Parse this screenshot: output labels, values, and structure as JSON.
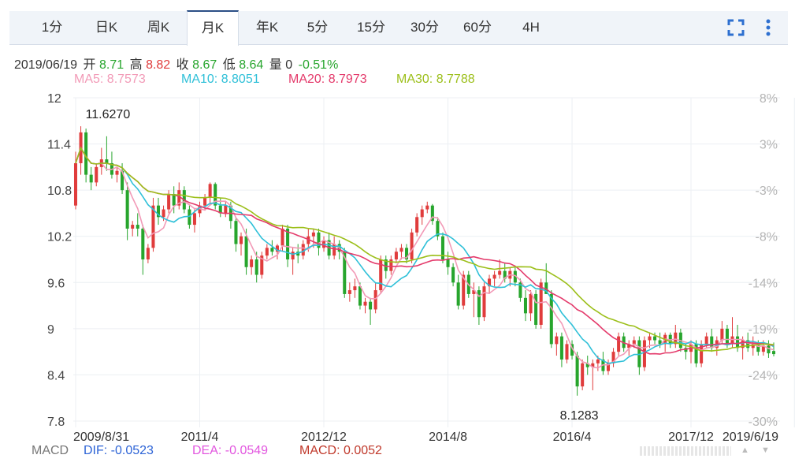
{
  "tabs": [
    {
      "label": "1分"
    },
    {
      "label": "日K"
    },
    {
      "label": "周K"
    },
    {
      "label": "月K",
      "active": true
    },
    {
      "label": "年K"
    },
    {
      "label": "5分"
    },
    {
      "label": "15分"
    },
    {
      "label": "30分"
    },
    {
      "label": "60分"
    },
    {
      "label": "4H"
    }
  ],
  "tools": {
    "fullscreen_icon": "fullscreen-icon",
    "more_icon": "more-vertical-icon"
  },
  "info": {
    "date": "2019/06/19",
    "open_label": "开",
    "open": "8.71",
    "high_label": "高",
    "high": "8.82",
    "close_label": "收",
    "close": "8.67",
    "low_label": "低",
    "low": "8.64",
    "vol_label": "量",
    "vol": "0",
    "change": "-0.51%"
  },
  "ma": {
    "ma5": "MA5: 8.7573",
    "ma10": "MA10: 8.8051",
    "ma20": "MA20: 8.7973",
    "ma30": "MA30: 8.7788"
  },
  "macd": {
    "name": "MACD",
    "dif": "DIF: -0.0523",
    "dea": "DEA: -0.0549",
    "macd": "MACD: 0.0052"
  },
  "colors": {
    "up": "#e03c3c",
    "down": "#27a52d",
    "ma5": "#f29ab7",
    "ma10": "#2fc0d8",
    "ma20": "#e43a6b",
    "ma30": "#9cbf1a",
    "dif": "#2c63d6",
    "dea": "#e256df",
    "macd": "#c0392b"
  },
  "chart_data": {
    "type": "candlestick",
    "ylim": [
      7.8,
      12
    ],
    "y_ticks": [
      "12",
      "11.4",
      "10.8",
      "10.2",
      "9.6",
      "9",
      "8.4",
      "7.8"
    ],
    "pct_ticks": [
      "8%",
      "3%",
      "-3%",
      "-8%",
      "-14%",
      "-19%",
      "-24%",
      "-30%"
    ],
    "x_ticks": [
      "2009/8/31",
      "2011/4",
      "2012/12",
      "2014/8",
      "2016/4",
      "2017/12",
      "2019/6/19"
    ],
    "max_label": "11.6270",
    "min_label": "8.1283",
    "candles": [
      {
        "o": 10.6,
        "h": 11.3,
        "l": 10.55,
        "c": 11.15
      },
      {
        "o": 11.15,
        "h": 11.63,
        "l": 11.0,
        "c": 11.55
      },
      {
        "o": 11.55,
        "h": 11.6,
        "l": 10.9,
        "c": 11.0
      },
      {
        "o": 11.0,
        "h": 11.1,
        "l": 10.8,
        "c": 10.9
      },
      {
        "o": 10.9,
        "h": 11.15,
        "l": 10.85,
        "c": 11.1
      },
      {
        "o": 11.1,
        "h": 11.35,
        "l": 11.0,
        "c": 11.2
      },
      {
        "o": 11.2,
        "h": 11.5,
        "l": 11.05,
        "c": 11.15
      },
      {
        "o": 11.15,
        "h": 11.3,
        "l": 10.95,
        "c": 11.0
      },
      {
        "o": 11.0,
        "h": 11.1,
        "l": 10.9,
        "c": 11.05
      },
      {
        "o": 11.05,
        "h": 11.15,
        "l": 10.75,
        "c": 10.8
      },
      {
        "o": 10.8,
        "h": 10.9,
        "l": 10.15,
        "c": 10.3
      },
      {
        "o": 10.3,
        "h": 10.4,
        "l": 10.2,
        "c": 10.35
      },
      {
        "o": 10.35,
        "h": 10.5,
        "l": 10.2,
        "c": 10.3
      },
      {
        "o": 10.3,
        "h": 10.35,
        "l": 9.7,
        "c": 9.9
      },
      {
        "o": 9.9,
        "h": 10.1,
        "l": 9.85,
        "c": 10.05
      },
      {
        "o": 10.05,
        "h": 10.7,
        "l": 10.0,
        "c": 10.6
      },
      {
        "o": 10.6,
        "h": 10.7,
        "l": 10.35,
        "c": 10.45
      },
      {
        "o": 10.45,
        "h": 10.6,
        "l": 10.4,
        "c": 10.55
      },
      {
        "o": 10.55,
        "h": 10.8,
        "l": 10.5,
        "c": 10.75
      },
      {
        "o": 10.75,
        "h": 10.85,
        "l": 10.5,
        "c": 10.6
      },
      {
        "o": 10.6,
        "h": 10.9,
        "l": 10.55,
        "c": 10.8
      },
      {
        "o": 10.8,
        "h": 10.85,
        "l": 10.5,
        "c": 10.55
      },
      {
        "o": 10.55,
        "h": 10.6,
        "l": 10.3,
        "c": 10.35
      },
      {
        "o": 10.35,
        "h": 10.55,
        "l": 10.25,
        "c": 10.5
      },
      {
        "o": 10.5,
        "h": 10.65,
        "l": 10.45,
        "c": 10.6
      },
      {
        "o": 10.6,
        "h": 10.75,
        "l": 10.55,
        "c": 10.7
      },
      {
        "o": 10.7,
        "h": 10.9,
        "l": 10.6,
        "c": 10.88
      },
      {
        "o": 10.88,
        "h": 10.9,
        "l": 10.55,
        "c": 10.6
      },
      {
        "o": 10.6,
        "h": 10.7,
        "l": 10.45,
        "c": 10.5
      },
      {
        "o": 10.5,
        "h": 10.65,
        "l": 10.45,
        "c": 10.6
      },
      {
        "o": 10.6,
        "h": 10.65,
        "l": 10.3,
        "c": 10.4
      },
      {
        "o": 10.4,
        "h": 10.45,
        "l": 10.0,
        "c": 10.1
      },
      {
        "o": 10.1,
        "h": 10.25,
        "l": 9.95,
        "c": 10.2
      },
      {
        "o": 10.2,
        "h": 10.3,
        "l": 9.7,
        "c": 9.8
      },
      {
        "o": 9.8,
        "h": 9.95,
        "l": 9.7,
        "c": 9.9
      },
      {
        "o": 9.9,
        "h": 10.0,
        "l": 9.6,
        "c": 9.7
      },
      {
        "o": 9.7,
        "h": 10.0,
        "l": 9.65,
        "c": 9.95
      },
      {
        "o": 9.95,
        "h": 10.1,
        "l": 9.9,
        "c": 10.05
      },
      {
        "o": 10.05,
        "h": 10.15,
        "l": 9.95,
        "c": 10.0
      },
      {
        "o": 10.0,
        "h": 10.1,
        "l": 9.9,
        "c": 10.08
      },
      {
        "o": 10.08,
        "h": 10.35,
        "l": 10.0,
        "c": 10.3
      },
      {
        "o": 10.3,
        "h": 10.35,
        "l": 9.8,
        "c": 9.9
      },
      {
        "o": 9.9,
        "h": 10.05,
        "l": 9.7,
        "c": 10.0
      },
      {
        "o": 10.0,
        "h": 10.1,
        "l": 9.85,
        "c": 9.95
      },
      {
        "o": 9.95,
        "h": 10.15,
        "l": 9.9,
        "c": 10.1
      },
      {
        "o": 10.1,
        "h": 10.3,
        "l": 10.0,
        "c": 10.2
      },
      {
        "o": 10.2,
        "h": 10.3,
        "l": 10.05,
        "c": 10.25
      },
      {
        "o": 10.25,
        "h": 10.3,
        "l": 9.95,
        "c": 10.05
      },
      {
        "o": 10.05,
        "h": 10.2,
        "l": 10.0,
        "c": 10.15
      },
      {
        "o": 10.15,
        "h": 10.25,
        "l": 9.9,
        "c": 9.95
      },
      {
        "o": 9.95,
        "h": 10.2,
        "l": 9.9,
        "c": 10.1
      },
      {
        "o": 10.1,
        "h": 10.15,
        "l": 9.9,
        "c": 10.0
      },
      {
        "o": 10.0,
        "h": 10.05,
        "l": 9.4,
        "c": 9.45
      },
      {
        "o": 9.45,
        "h": 9.6,
        "l": 9.35,
        "c": 9.5
      },
      {
        "o": 9.5,
        "h": 9.65,
        "l": 9.4,
        "c": 9.55
      },
      {
        "o": 9.55,
        "h": 9.6,
        "l": 9.25,
        "c": 9.3
      },
      {
        "o": 9.3,
        "h": 9.4,
        "l": 9.2,
        "c": 9.35
      },
      {
        "o": 9.35,
        "h": 9.4,
        "l": 9.05,
        "c": 9.25
      },
      {
        "o": 9.25,
        "h": 9.6,
        "l": 9.2,
        "c": 9.5
      },
      {
        "o": 9.5,
        "h": 9.95,
        "l": 9.45,
        "c": 9.9
      },
      {
        "o": 9.9,
        "h": 9.95,
        "l": 9.65,
        "c": 9.75
      },
      {
        "o": 9.75,
        "h": 9.95,
        "l": 9.7,
        "c": 9.9
      },
      {
        "o": 9.9,
        "h": 10.05,
        "l": 9.85,
        "c": 10.0
      },
      {
        "o": 10.0,
        "h": 10.1,
        "l": 9.9,
        "c": 10.05
      },
      {
        "o": 10.05,
        "h": 10.1,
        "l": 9.85,
        "c": 9.9
      },
      {
        "o": 9.9,
        "h": 10.3,
        "l": 9.85,
        "c": 10.25
      },
      {
        "o": 10.25,
        "h": 10.5,
        "l": 10.2,
        "c": 10.45
      },
      {
        "o": 10.45,
        "h": 10.6,
        "l": 10.35,
        "c": 10.55
      },
      {
        "o": 10.55,
        "h": 10.65,
        "l": 10.5,
        "c": 10.6
      },
      {
        "o": 10.6,
        "h": 10.62,
        "l": 10.35,
        "c": 10.4
      },
      {
        "o": 10.4,
        "h": 10.45,
        "l": 10.15,
        "c": 10.2
      },
      {
        "o": 10.2,
        "h": 10.25,
        "l": 9.85,
        "c": 9.9
      },
      {
        "o": 9.9,
        "h": 10.0,
        "l": 9.7,
        "c": 9.8
      },
      {
        "o": 9.8,
        "h": 9.85,
        "l": 9.55,
        "c": 9.6
      },
      {
        "o": 9.6,
        "h": 9.7,
        "l": 9.25,
        "c": 9.3
      },
      {
        "o": 9.3,
        "h": 9.75,
        "l": 9.25,
        "c": 9.7
      },
      {
        "o": 9.7,
        "h": 9.75,
        "l": 9.4,
        "c": 9.45
      },
      {
        "o": 9.45,
        "h": 9.6,
        "l": 9.15,
        "c": 9.5
      },
      {
        "o": 9.5,
        "h": 9.55,
        "l": 9.05,
        "c": 9.15
      },
      {
        "o": 9.15,
        "h": 9.6,
        "l": 9.1,
        "c": 9.55
      },
      {
        "o": 9.55,
        "h": 9.7,
        "l": 9.45,
        "c": 9.65
      },
      {
        "o": 9.65,
        "h": 9.75,
        "l": 9.55,
        "c": 9.7
      },
      {
        "o": 9.7,
        "h": 9.9,
        "l": 9.65,
        "c": 9.75
      },
      {
        "o": 9.75,
        "h": 9.85,
        "l": 9.6,
        "c": 9.65
      },
      {
        "o": 9.65,
        "h": 9.8,
        "l": 9.55,
        "c": 9.75
      },
      {
        "o": 9.75,
        "h": 9.8,
        "l": 9.55,
        "c": 9.6
      },
      {
        "o": 9.6,
        "h": 9.65,
        "l": 9.35,
        "c": 9.4
      },
      {
        "o": 9.4,
        "h": 9.5,
        "l": 9.1,
        "c": 9.2
      },
      {
        "o": 9.2,
        "h": 9.5,
        "l": 9.1,
        "c": 9.45
      },
      {
        "o": 9.45,
        "h": 9.5,
        "l": 9.0,
        "c": 9.05
      },
      {
        "o": 9.05,
        "h": 9.65,
        "l": 9.0,
        "c": 9.6
      },
      {
        "o": 9.6,
        "h": 9.85,
        "l": 9.55,
        "c": 9.45
      },
      {
        "o": 9.45,
        "h": 9.5,
        "l": 8.75,
        "c": 8.8
      },
      {
        "o": 8.8,
        "h": 8.95,
        "l": 8.65,
        "c": 8.9
      },
      {
        "o": 8.9,
        "h": 8.95,
        "l": 8.5,
        "c": 8.6
      },
      {
        "o": 8.6,
        "h": 8.85,
        "l": 8.55,
        "c": 8.8
      },
      {
        "o": 8.8,
        "h": 8.85,
        "l": 8.6,
        "c": 8.65
      },
      {
        "o": 8.65,
        "h": 8.7,
        "l": 8.13,
        "c": 8.25
      },
      {
        "o": 8.25,
        "h": 8.6,
        "l": 8.2,
        "c": 8.55
      },
      {
        "o": 8.55,
        "h": 8.65,
        "l": 8.4,
        "c": 8.5
      },
      {
        "o": 8.5,
        "h": 8.6,
        "l": 8.2,
        "c": 8.55
      },
      {
        "o": 8.55,
        "h": 8.65,
        "l": 8.45,
        "c": 8.6
      },
      {
        "o": 8.6,
        "h": 8.7,
        "l": 8.4,
        "c": 8.45
      },
      {
        "o": 8.45,
        "h": 8.6,
        "l": 8.4,
        "c": 8.55
      },
      {
        "o": 8.55,
        "h": 8.75,
        "l": 8.5,
        "c": 8.7
      },
      {
        "o": 8.7,
        "h": 8.95,
        "l": 8.65,
        "c": 8.9
      },
      {
        "o": 8.9,
        "h": 8.95,
        "l": 8.7,
        "c": 8.75
      },
      {
        "o": 8.75,
        "h": 8.85,
        "l": 8.65,
        "c": 8.8
      },
      {
        "o": 8.8,
        "h": 8.9,
        "l": 8.75,
        "c": 8.85
      },
      {
        "o": 8.85,
        "h": 8.9,
        "l": 8.4,
        "c": 8.5
      },
      {
        "o": 8.5,
        "h": 8.9,
        "l": 8.45,
        "c": 8.85
      },
      {
        "o": 8.85,
        "h": 8.95,
        "l": 8.75,
        "c": 8.9
      },
      {
        "o": 8.9,
        "h": 8.95,
        "l": 8.8,
        "c": 8.85
      },
      {
        "o": 8.85,
        "h": 8.95,
        "l": 8.75,
        "c": 8.8
      },
      {
        "o": 8.8,
        "h": 8.95,
        "l": 8.7,
        "c": 8.92
      },
      {
        "o": 8.92,
        "h": 8.95,
        "l": 8.75,
        "c": 8.8
      },
      {
        "o": 8.8,
        "h": 9.05,
        "l": 8.75,
        "c": 8.95
      },
      {
        "o": 8.95,
        "h": 9.0,
        "l": 8.7,
        "c": 8.75
      },
      {
        "o": 8.75,
        "h": 8.8,
        "l": 8.6,
        "c": 8.7
      },
      {
        "o": 8.7,
        "h": 8.85,
        "l": 8.55,
        "c": 8.8
      },
      {
        "o": 8.8,
        "h": 8.85,
        "l": 8.5,
        "c": 8.55
      },
      {
        "o": 8.55,
        "h": 8.85,
        "l": 8.5,
        "c": 8.8
      },
      {
        "o": 8.8,
        "h": 8.95,
        "l": 8.75,
        "c": 8.9
      },
      {
        "o": 8.9,
        "h": 9.0,
        "l": 8.7,
        "c": 8.75
      },
      {
        "o": 8.75,
        "h": 8.9,
        "l": 8.65,
        "c": 8.85
      },
      {
        "o": 8.85,
        "h": 9.1,
        "l": 8.8,
        "c": 9.0
      },
      {
        "o": 9.0,
        "h": 9.05,
        "l": 8.75,
        "c": 8.8
      },
      {
        "o": 8.8,
        "h": 9.15,
        "l": 8.75,
        "c": 8.9
      },
      {
        "o": 8.9,
        "h": 9.05,
        "l": 8.7,
        "c": 8.75
      },
      {
        "o": 8.75,
        "h": 8.9,
        "l": 8.6,
        "c": 8.85
      },
      {
        "o": 8.85,
        "h": 8.95,
        "l": 8.7,
        "c": 8.75
      },
      {
        "o": 8.75,
        "h": 8.9,
        "l": 8.65,
        "c": 8.8
      },
      {
        "o": 8.8,
        "h": 8.85,
        "l": 8.65,
        "c": 8.7
      },
      {
        "o": 8.7,
        "h": 8.85,
        "l": 8.65,
        "c": 8.78
      },
      {
        "o": 8.78,
        "h": 8.85,
        "l": 8.62,
        "c": 8.68
      },
      {
        "o": 8.71,
        "h": 8.82,
        "l": 8.64,
        "c": 8.67
      }
    ]
  }
}
